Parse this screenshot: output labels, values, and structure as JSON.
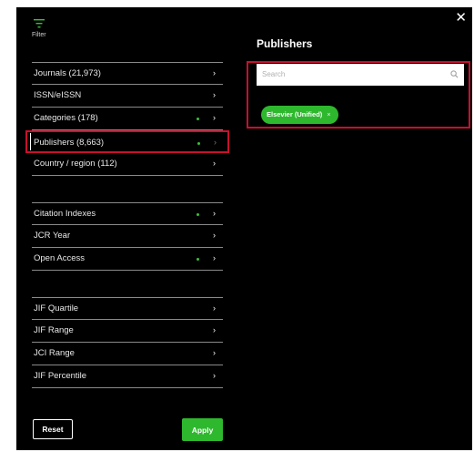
{
  "header": {
    "filter_label": "Filter",
    "close_symbol": "✕",
    "icons": {
      "filter": "filter-icon",
      "close": "close-icon"
    }
  },
  "nav": {
    "group1": [
      {
        "label": "Journals (21,973)",
        "has_dot": false
      },
      {
        "label": "ISSN/eISSN",
        "has_dot": false
      },
      {
        "label": "Categories (178)",
        "has_dot": true
      },
      {
        "label": "Publishers (8,663)",
        "has_dot": true,
        "selected": true
      },
      {
        "label": "Country / region (112)",
        "has_dot": false
      }
    ],
    "group2": [
      {
        "label": "Citation Indexes",
        "has_dot": true
      },
      {
        "label": "JCR Year",
        "has_dot": false
      },
      {
        "label": "Open Access",
        "has_dot": true
      }
    ],
    "group3": [
      {
        "label": "JIF Quartile",
        "has_dot": false
      },
      {
        "label": "JIF Range",
        "has_dot": false
      },
      {
        "label": "JCI Range",
        "has_dot": false
      },
      {
        "label": "JIF Percentile",
        "has_dot": false
      }
    ],
    "chevron": "›",
    "dot_color": "#3cbf3c"
  },
  "publishers": {
    "title": "Publishers",
    "search_placeholder": "Search",
    "chip_label": "Elsevier (Unified)",
    "chip_remove": "×"
  },
  "footer": {
    "reset_label": "Reset",
    "apply_label": "Apply"
  },
  "colors": {
    "panel_bg": "#000000",
    "accent_green": "#2eb82e",
    "highlight_red": "#c8102e"
  }
}
